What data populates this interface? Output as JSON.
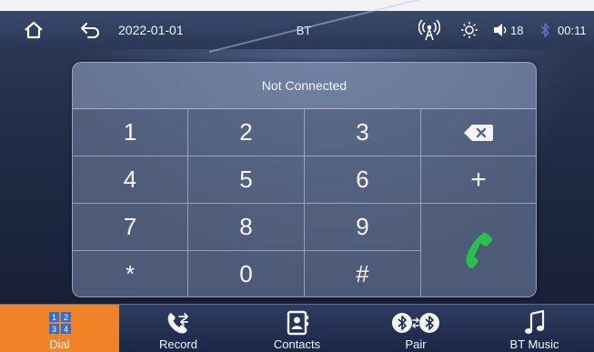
{
  "status_bar": {
    "date": "2022-01-01",
    "mode": "BT",
    "volume": "18",
    "time": "00:11"
  },
  "dialpad": {
    "status": "Not Connected",
    "keys": [
      "1",
      "2",
      "3",
      "4",
      "5",
      "6",
      "7",
      "8",
      "9",
      "*",
      "0",
      "#"
    ],
    "plus_label": "+"
  },
  "bottom_nav": {
    "items": [
      {
        "label": "Dial",
        "icon": "dial-grid-icon",
        "active": true
      },
      {
        "label": "Record",
        "icon": "call-log-icon",
        "active": false
      },
      {
        "label": "Contacts",
        "icon": "contacts-icon",
        "active": false
      },
      {
        "label": "Pair",
        "icon": "bt-pair-icon",
        "active": false
      },
      {
        "label": "BT Music",
        "icon": "music-note-icon",
        "active": false
      }
    ],
    "active_color": "#f08228"
  },
  "colors": {
    "call_button": "#27c24a",
    "bluetooth_icon": "#5a74b8"
  }
}
